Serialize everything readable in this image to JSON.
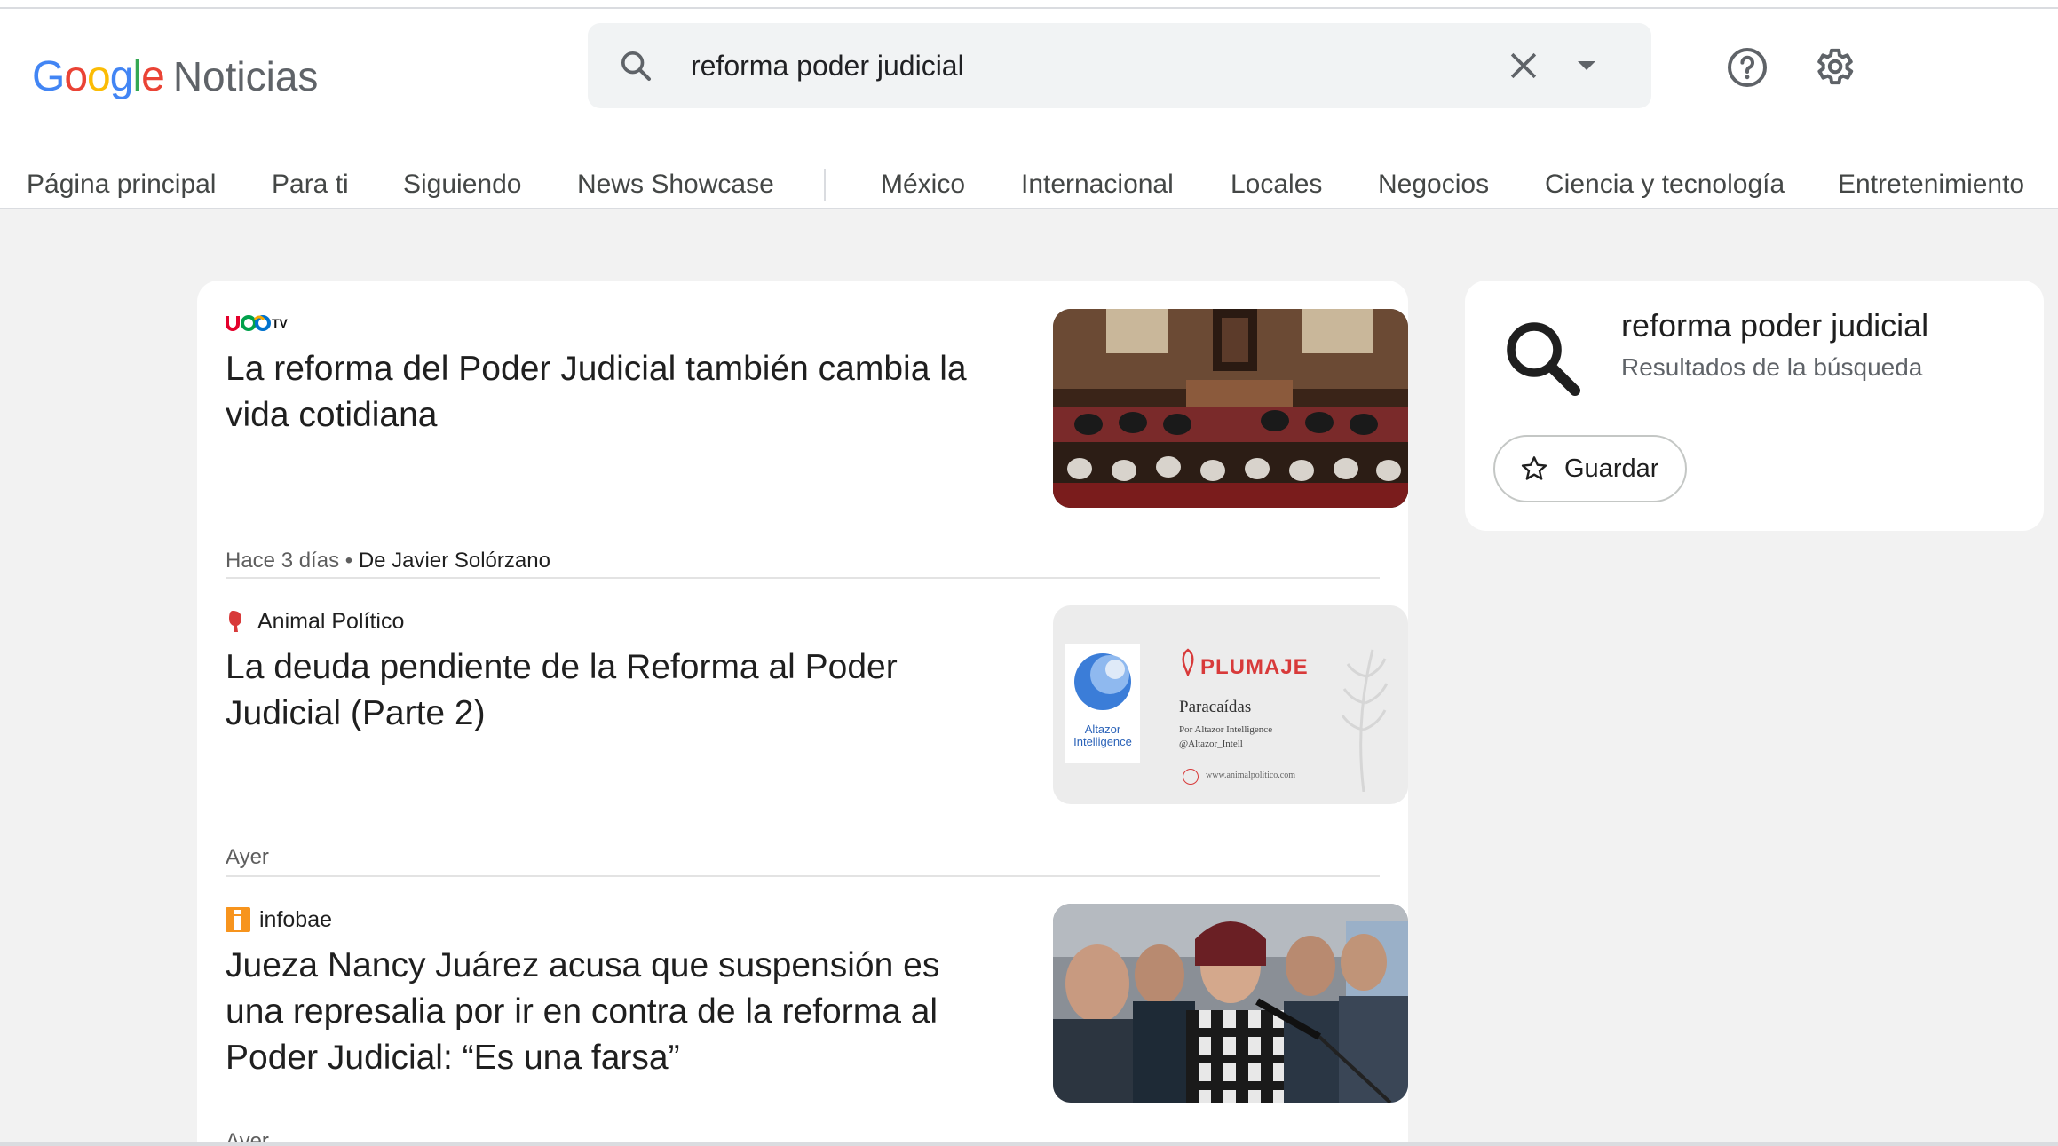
{
  "app": {
    "logo_google": "Google",
    "logo_product": "Noticias"
  },
  "search": {
    "query": "reforma poder judicial"
  },
  "nav": {
    "items": [
      "Página principal",
      "Para ti",
      "Siguiendo",
      "News Showcase",
      "México",
      "Internacional",
      "Locales",
      "Negocios",
      "Ciencia y tecnología",
      "Entretenimiento"
    ]
  },
  "articles": [
    {
      "source": "",
      "source_logo": "uno-tv-logo",
      "title": "La reforma del Poder Judicial también cambia la vida cotidiana",
      "time": "Hace 3 días",
      "separator": " • ",
      "author": "De Javier Solórzano",
      "thumbnail": "courtroom-photo"
    },
    {
      "source": "Animal Político",
      "source_logo": "animal-politico-logo",
      "title": "La deuda pendiente de la Reforma al Poder Judicial (Parte 2)",
      "time": "Ayer",
      "author": "",
      "thumbnail": "plumaje-graphic",
      "thumb_text": {
        "brand": "PLUMAJE",
        "headline": "Paracaídas",
        "byline": "Por Altazor Intelligence",
        "handle": "@Altazor_Intell",
        "logo_text": "Altazor Intelligence",
        "url": "www.animalpolitico.com"
      }
    },
    {
      "source": "infobae",
      "source_logo": "infobae-logo",
      "title": "Jueza Nancy Juárez acusa que suspensión es una represalia por ir en contra de la reforma al Poder Judicial: “Es una farsa”",
      "time": "Ayer",
      "author": "",
      "thumbnail": "press-conference-photo"
    }
  ],
  "side_panel": {
    "query": "reforma poder judicial",
    "subtitle": "Resultados de la búsqueda",
    "save_label": "Guardar"
  },
  "colors": {
    "google_blue": "#4285F4",
    "google_red": "#EA4335",
    "google_yellow": "#FBBC05",
    "google_green": "#34A853",
    "plumaje_red": "#d83a3a",
    "infobae_orange": "#f7941d"
  }
}
